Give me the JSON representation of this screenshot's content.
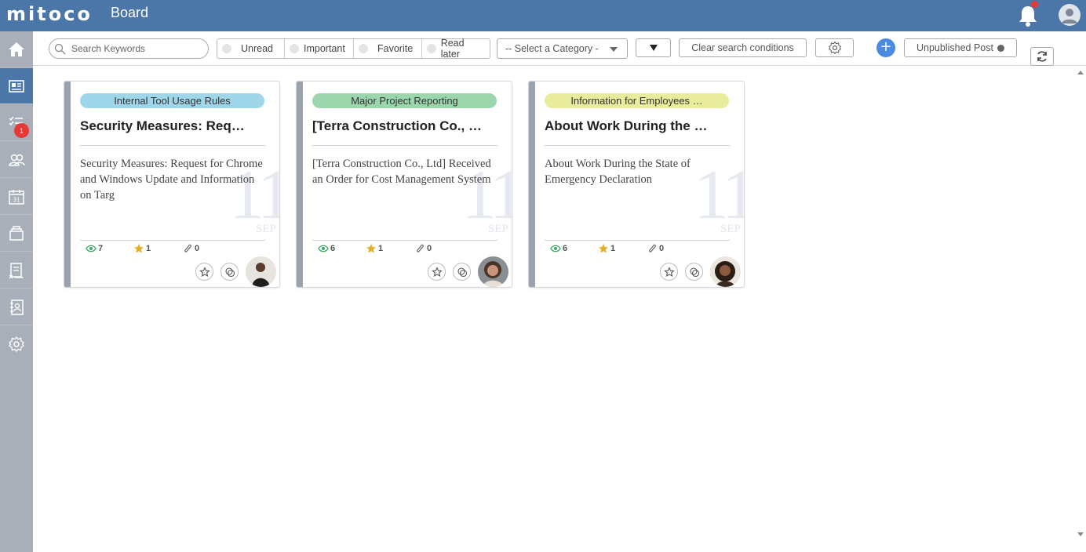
{
  "header": {
    "logo": "mitoco",
    "title": "Board",
    "notification_dot": "#e53935"
  },
  "sidebar": {
    "items": [
      {
        "icon": "home-icon"
      },
      {
        "icon": "board-icon",
        "active": true
      },
      {
        "icon": "todo-list-icon",
        "badge": "1"
      },
      {
        "icon": "people-icon"
      },
      {
        "icon": "calendar-icon",
        "calendar_number": "31"
      },
      {
        "icon": "files-icon"
      },
      {
        "icon": "expense-icon"
      },
      {
        "icon": "address-book-icon"
      },
      {
        "icon": "gear-icon"
      }
    ]
  },
  "toolbar": {
    "search_placeholder": "Search Keywords",
    "filters": [
      "Unread",
      "Important",
      "Favorite",
      "Read later"
    ],
    "category_placeholder": "-- Select a Category -",
    "clear_label": "Clear search conditions",
    "unpublished_label": "Unpublished Post"
  },
  "colors": {
    "brand": "#4a76a8",
    "sidebar": "#a9afb8",
    "accent_plus": "#4a8be0"
  },
  "cards": [
    {
      "tag": "Internal Tool Usage Rules",
      "tag_color": "#9fd6ea",
      "title": "Security Measures: Req…",
      "body": "Security Measures: Request for Chrome and Windows Update and Information on Targ",
      "day": "11",
      "month": "SEP",
      "views": "7",
      "stars": "1",
      "attachments": "0"
    },
    {
      "tag": "Major Project Reporting",
      "tag_color": "#9cd6ac",
      "title": "[Terra Construction Co., …",
      "body": "[Terra Construction Co., Ltd] Received an Order for Cost Management System",
      "day": "11",
      "month": "SEP",
      "views": "6",
      "stars": "1",
      "attachments": "0"
    },
    {
      "tag": "Information for Employees …",
      "tag_color": "#e8ec9c",
      "title": "About Work During the …",
      "body": "About Work During the State of Emergency Declaration",
      "day": "11",
      "month": "SEP",
      "views": "6",
      "stars": "1",
      "attachments": "0"
    }
  ]
}
